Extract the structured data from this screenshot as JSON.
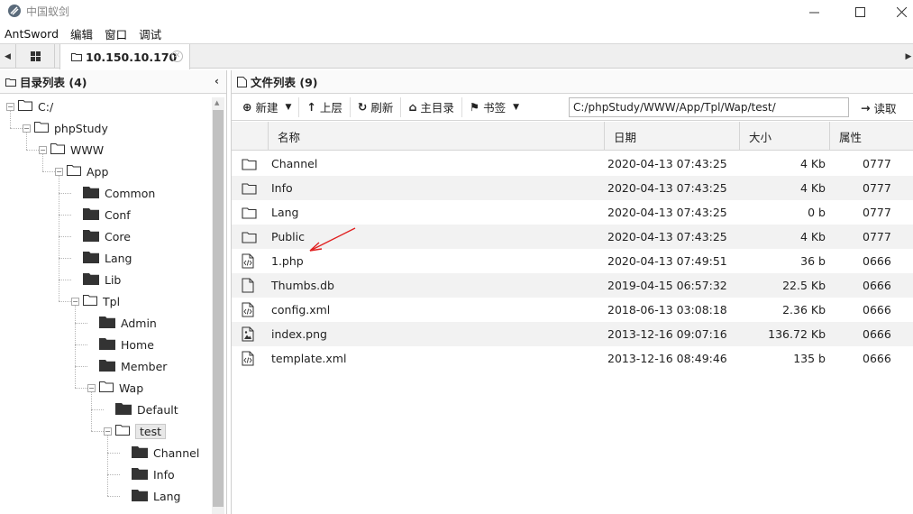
{
  "window": {
    "title": "中国蚁剑"
  },
  "menu": [
    "AntSword",
    "编辑",
    "窗口",
    "调试"
  ],
  "tab": {
    "label": "10.150.10.170"
  },
  "left": {
    "title": "目录列表 (4)",
    "tree": [
      {
        "label": "C:/",
        "depth": 0,
        "open": true
      },
      {
        "label": "phpStudy",
        "depth": 1,
        "open": true
      },
      {
        "label": "WWW",
        "depth": 2,
        "open": true
      },
      {
        "label": "App",
        "depth": 3,
        "open": true
      },
      {
        "label": "Common",
        "depth": 4
      },
      {
        "label": "Conf",
        "depth": 4
      },
      {
        "label": "Core",
        "depth": 4
      },
      {
        "label": "Lang",
        "depth": 4
      },
      {
        "label": "Lib",
        "depth": 4
      },
      {
        "label": "Tpl",
        "depth": 4,
        "open": true
      },
      {
        "label": "Admin",
        "depth": 5
      },
      {
        "label": "Home",
        "depth": 5
      },
      {
        "label": "Member",
        "depth": 5
      },
      {
        "label": "Wap",
        "depth": 5,
        "open": true
      },
      {
        "label": "Default",
        "depth": 6
      },
      {
        "label": "test",
        "depth": 6,
        "open": true,
        "selected": true
      },
      {
        "label": "Channel",
        "depth": 7
      },
      {
        "label": "Info",
        "depth": 7
      },
      {
        "label": "Lang",
        "depth": 7
      }
    ]
  },
  "right": {
    "title": "文件列表 (9)",
    "toolbar": {
      "new": "新建",
      "up": "上层",
      "refresh": "刷新",
      "home": "主目录",
      "bookmark": "书签",
      "path": "C:/phpStudy/WWW/App/Tpl/Wap/test/",
      "read": "读取"
    },
    "columns": {
      "name": "名称",
      "date": "日期",
      "size": "大小",
      "attr": "属性"
    },
    "files": [
      {
        "type": "folder",
        "name": "Channel",
        "date": "2020-04-13 07:43:25",
        "size": "4 Kb",
        "attr": "0777"
      },
      {
        "type": "folder",
        "name": "Info",
        "date": "2020-04-13 07:43:25",
        "size": "4 Kb",
        "attr": "0777"
      },
      {
        "type": "folder",
        "name": "Lang",
        "date": "2020-04-13 07:43:25",
        "size": "0 b",
        "attr": "0777"
      },
      {
        "type": "folder",
        "name": "Public",
        "date": "2020-04-13 07:43:25",
        "size": "4 Kb",
        "attr": "0777"
      },
      {
        "type": "code",
        "name": "1.php",
        "date": "2020-04-13 07:49:51",
        "size": "36 b",
        "attr": "0666"
      },
      {
        "type": "file",
        "name": "Thumbs.db",
        "date": "2019-04-15 06:57:32",
        "size": "22.5 Kb",
        "attr": "0666"
      },
      {
        "type": "code",
        "name": "config.xml",
        "date": "2018-06-13 03:08:18",
        "size": "2.36 Kb",
        "attr": "0666"
      },
      {
        "type": "image",
        "name": "index.png",
        "date": "2013-12-16 09:07:16",
        "size": "136.72 Kb",
        "attr": "0666"
      },
      {
        "type": "code",
        "name": "template.xml",
        "date": "2013-12-16 08:49:46",
        "size": "135 b",
        "attr": "0666"
      }
    ]
  },
  "colors": {
    "annotation": "#e02020",
    "alt_row": "#f2f2f2"
  }
}
